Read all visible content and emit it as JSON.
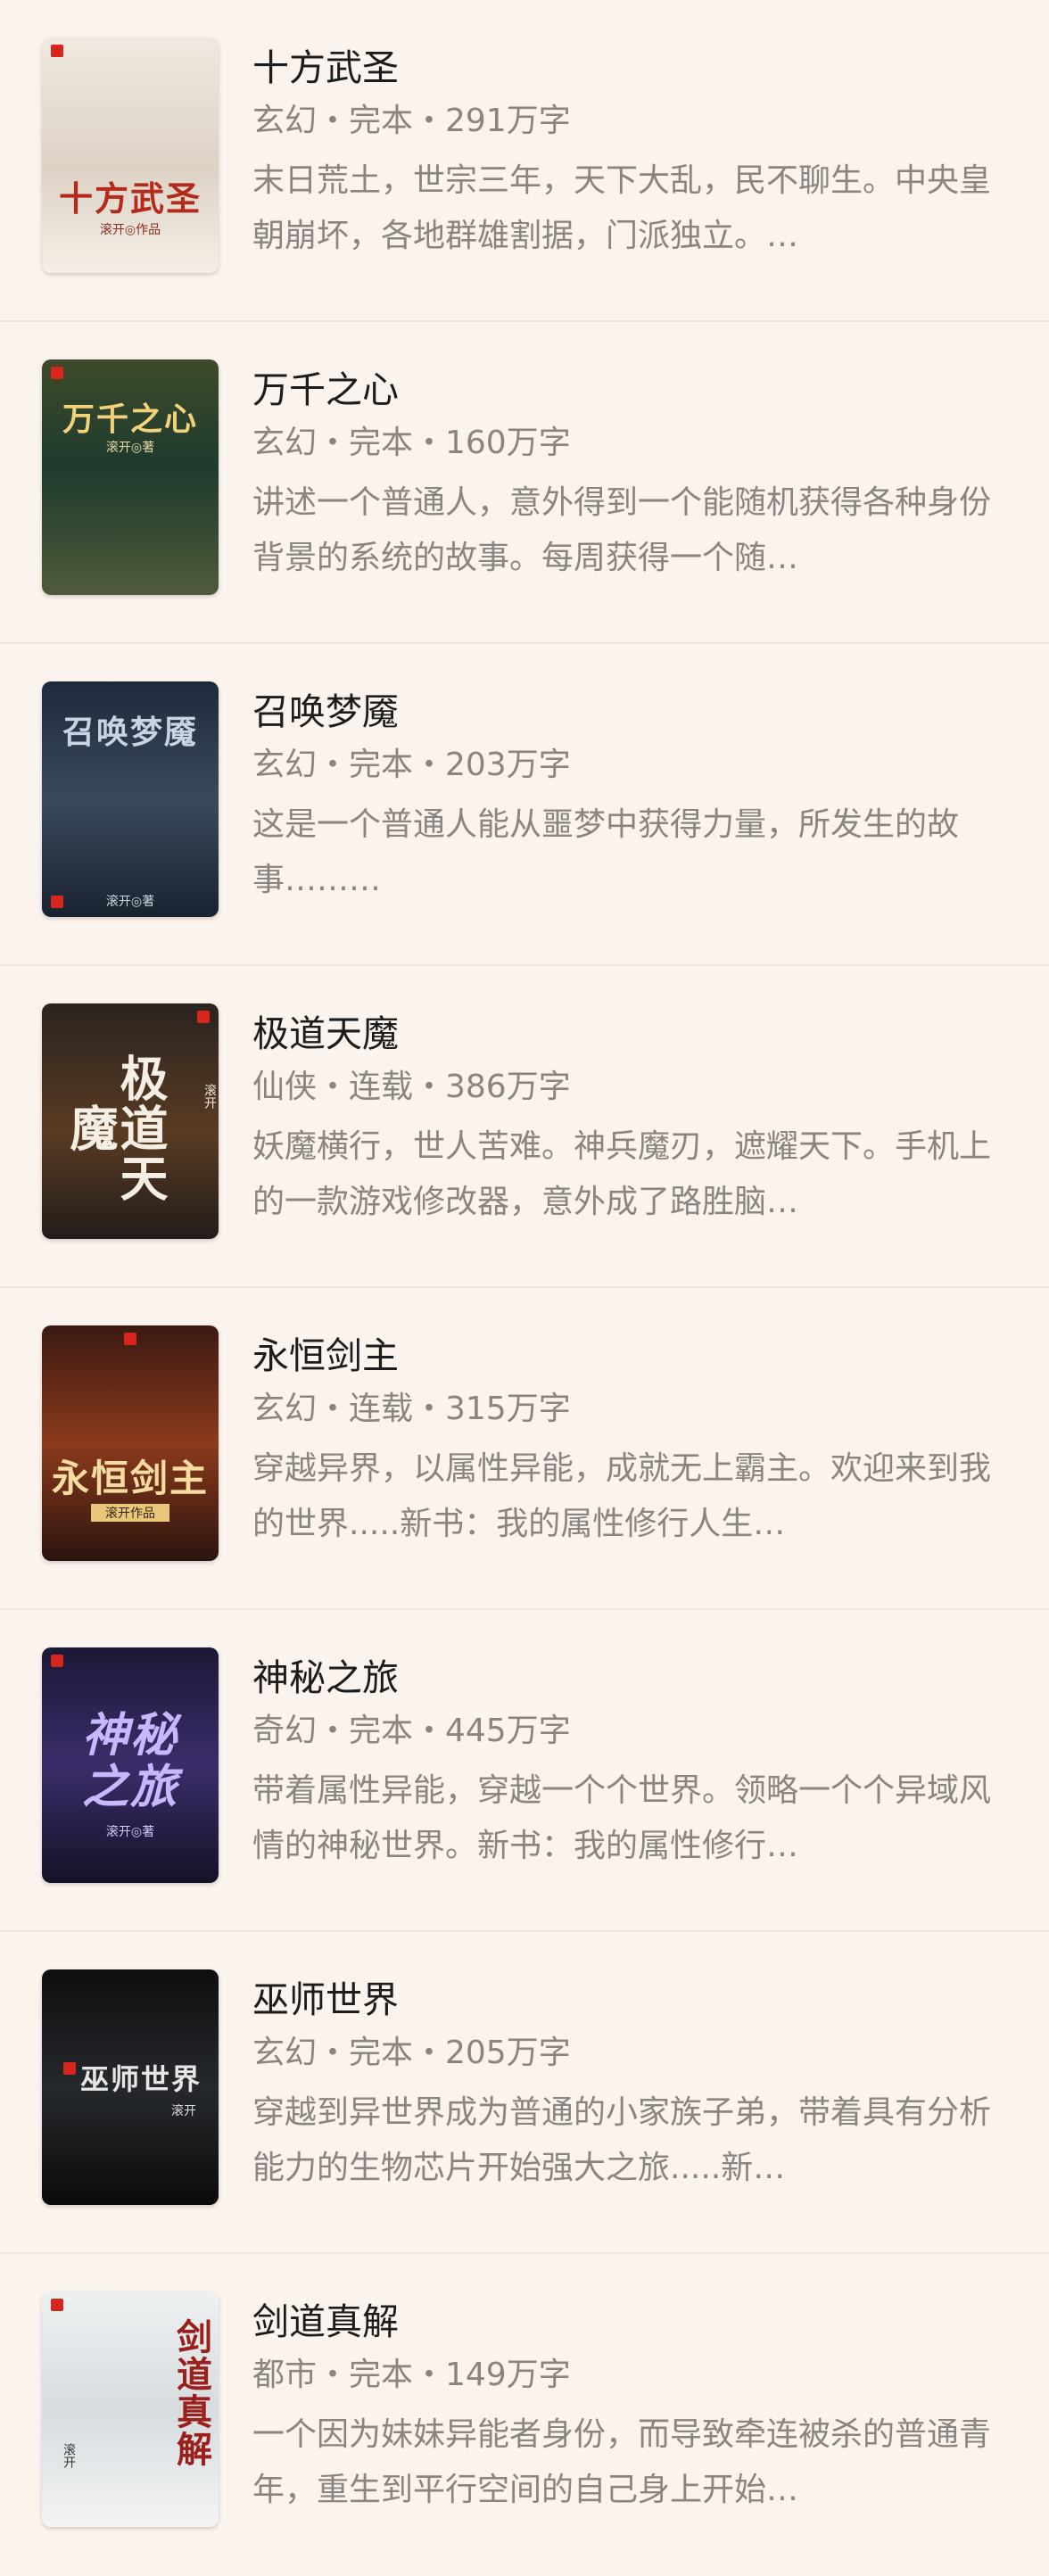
{
  "books": [
    {
      "title": "十方武圣",
      "meta": "玄幻・完本・291万字",
      "desc": "末日荒土，世宗三年，天下大乱，民不聊生。中央皇朝崩坏，各地群雄割据，门派独立。…",
      "cover": {
        "title": "十方武圣",
        "author": "滚开◎作品",
        "bg": "linear-gradient(180deg,#efe9e1 0%,#ddd2c4 55%,#f4efe7 100%)",
        "title_color": "#b42b1e"
      }
    },
    {
      "title": "万千之心",
      "meta": "玄幻・完本・160万字",
      "desc": "讲述一个普通人，意外得到一个能随机获得各种身份背景的系统的故事。每周获得一个随…",
      "cover": {
        "title": "万千之心",
        "author": "滚开◎著",
        "bg": "linear-gradient(180deg,#3f4b2a 0%,#1e3b2e 45%,#4f5a3a 100%)",
        "title_color": "#f2d27a"
      }
    },
    {
      "title": "召唤梦魇",
      "meta": "玄幻・完本・203万字",
      "desc": "这是一个普通人能从噩梦中获得力量，所发生的故事………",
      "cover": {
        "title": "召唤梦魇",
        "author": "滚开◎著",
        "bg": "linear-gradient(180deg,#1d2a3c 0%,#3a4a5c 50%,#1a2330 100%)",
        "title_color": "#c9d4e2"
      }
    },
    {
      "title": "极道天魔",
      "meta": "仙侠・连载・386万字",
      "desc": "妖魔横行，世人苦难。神兵魔刃，遮耀天下。手机上的一款游戏修改器，意外成了路胜脑…",
      "cover": {
        "title": "极道天魔",
        "author": "滚开",
        "bg": "linear-gradient(180deg,#2a2420 0%,#5a3b22 55%,#221d1a 100%)",
        "title_color": "#f4eee4"
      }
    },
    {
      "title": "永恒剑主",
      "meta": "玄幻・连载・315万字",
      "desc": "穿越异界，以属性异能，成就无上霸主。欢迎来到我的世界.....新书：我的属性修行人生…",
      "cover": {
        "title": "永恒剑主",
        "author": "滚开作品",
        "bg": "linear-gradient(180deg,#3b1a12 0%,#8c3a1c 50%,#2b140e 100%)",
        "title_color": "#f6dca0"
      }
    },
    {
      "title": "神秘之旅",
      "meta": "奇幻・完本・445万字",
      "desc": "带着属性异能，穿越一个个世界。领略一个个异域风情的神秘世界。新书：我的属性修行…",
      "cover": {
        "title": "神秘之旅",
        "author": "滚开◎著",
        "bg": "linear-gradient(180deg,#1b1836 0%,#3b2d6a 50%,#141227 100%)",
        "title_color": "#c8b6ff"
      }
    },
    {
      "title": "巫师世界",
      "meta": "玄幻・完本・205万字",
      "desc": "穿越到异世界成为普通的小家族子弟，带着具有分析能力的生物芯片开始强大之旅.....新…",
      "cover": {
        "title": "巫师世界",
        "author": "滚开",
        "bg": "linear-gradient(180deg,#0d0e10 0%,#26292c 50%,#0b0b0c 100%)",
        "title_color": "#e6e6e6"
      }
    },
    {
      "title": "剑道真解",
      "meta": "都市・完本・149万字",
      "desc": "一个因为妹妹异能者身份，而导致牵连被杀的普通青年，重生到平行空间的自己身上开始…",
      "cover": {
        "title": "剑道真解",
        "author": "滚开",
        "bg": "linear-gradient(180deg,#eef1f2 0%,#d7dcdf 50%,#f3f4f4 100%)",
        "title_color": "#9b1f1b"
      }
    }
  ]
}
